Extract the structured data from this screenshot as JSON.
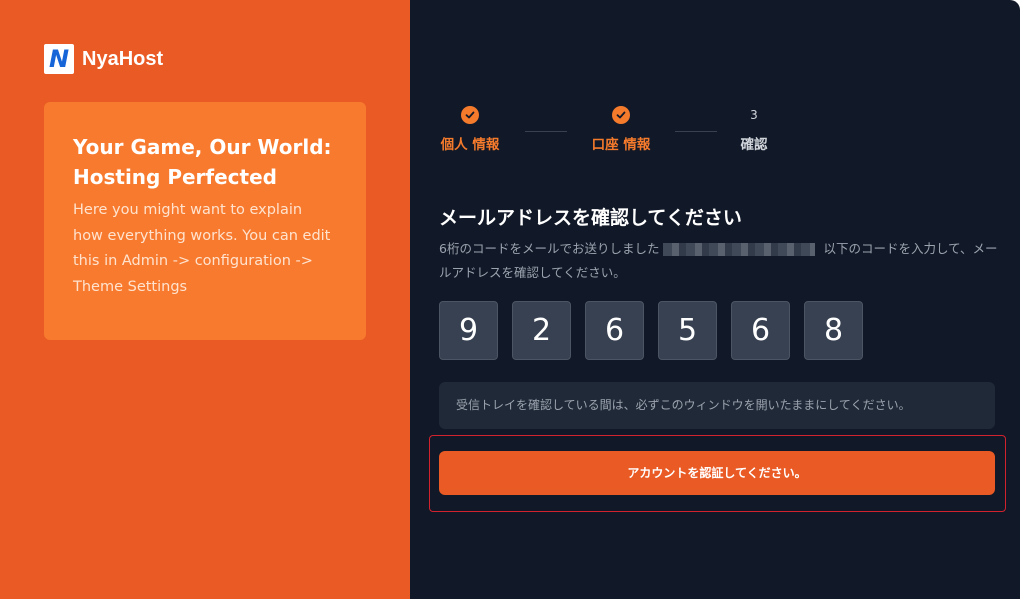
{
  "brand": {
    "logo_letter": "N",
    "name": "NyaHost",
    "accent_color": "#e95a24"
  },
  "hero": {
    "title": "Your Game, Our World: Hosting Perfected",
    "text": "Here you might want to explain how everything works. You can edit this in Admin -> configuration -> Theme Settings"
  },
  "steps": [
    {
      "label": "個人 情報",
      "status": "done",
      "icon": "check-icon"
    },
    {
      "label": "口座 情報",
      "status": "done",
      "icon": "check-icon"
    },
    {
      "number": "3",
      "label": "確認",
      "status": "current"
    }
  ],
  "verify": {
    "title": "メールアドレスを確認してください",
    "desc_before": "6桁のコードをメールでお送りしました",
    "desc_after": "以下のコードを入力して、メールアドレスを確認してください。",
    "code_digits": [
      "9",
      "2",
      "6",
      "5",
      "6",
      "8"
    ],
    "notice": "受信トレイを確認している間は、必ずこのウィンドウを開いたままにしてください。",
    "button_label": "アカウントを認証してください。"
  }
}
